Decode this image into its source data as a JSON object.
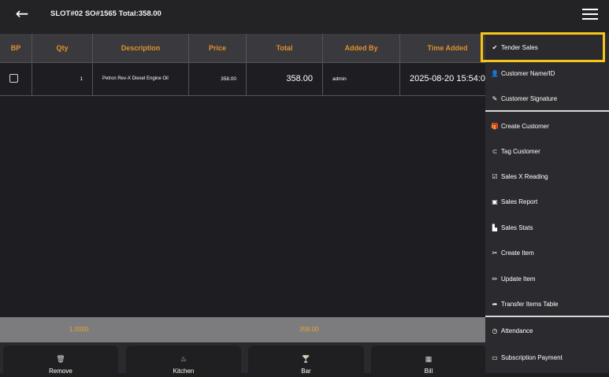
{
  "header": {
    "title": "SLOT#02 SO#1565 Total:358.00",
    "back_icon": "arrow-left-icon",
    "menu_icon": "hamburger-icon"
  },
  "table": {
    "columns": [
      "BP",
      "Qty",
      "Description",
      "Price",
      "Total",
      "Added By",
      "Time Added"
    ],
    "rows": [
      {
        "checked": false,
        "qty": "1",
        "description": "Petron Rev-X Diesel Engine Oil",
        "price": "358.00",
        "total": "358.00",
        "added_by": "admin",
        "time_added": "2025-08-20 15:54:0"
      }
    ]
  },
  "summary": {
    "qty_total": "1.0000",
    "amount_total": "358.00"
  },
  "actions": [
    {
      "label": "Remove",
      "icon": "trash-icon"
    },
    {
      "label": "Kitchen",
      "icon": "kitchen-icon"
    },
    {
      "label": "Bar",
      "icon": "cocktail-icon"
    },
    {
      "label": "Bill",
      "icon": "calculator-icon"
    }
  ],
  "side_menu": [
    {
      "label": "Tender Sales",
      "icon": "check-icon",
      "highlighted": true
    },
    {
      "label": "Customer Name/ID",
      "icon": "user-icon"
    },
    {
      "label": "Customer Signature",
      "icon": "signature-icon"
    },
    {
      "label": "Create Customer",
      "icon": "gift-icon"
    },
    {
      "label": "Tag Customer",
      "icon": "tag-icon"
    },
    {
      "label": "Sales X Reading",
      "icon": "clipboard-check-icon"
    },
    {
      "label": "Sales Report",
      "icon": "money-icon"
    },
    {
      "label": "Sales Stats",
      "icon": "bar-chart-icon"
    },
    {
      "label": "Create Item",
      "icon": "tools-icon"
    },
    {
      "label": "Update Item",
      "icon": "pencil-icon"
    },
    {
      "label": "Transfer Items Table",
      "icon": "share-arrow-icon"
    },
    {
      "label": "Attendance",
      "icon": "clock-icon"
    },
    {
      "label": "Subscription Payment",
      "icon": "credit-card-icon"
    }
  ],
  "colors": {
    "accent": "#e0912a",
    "highlight": "#f5c518",
    "background": "#1e1d22",
    "header": "#3a393e"
  }
}
